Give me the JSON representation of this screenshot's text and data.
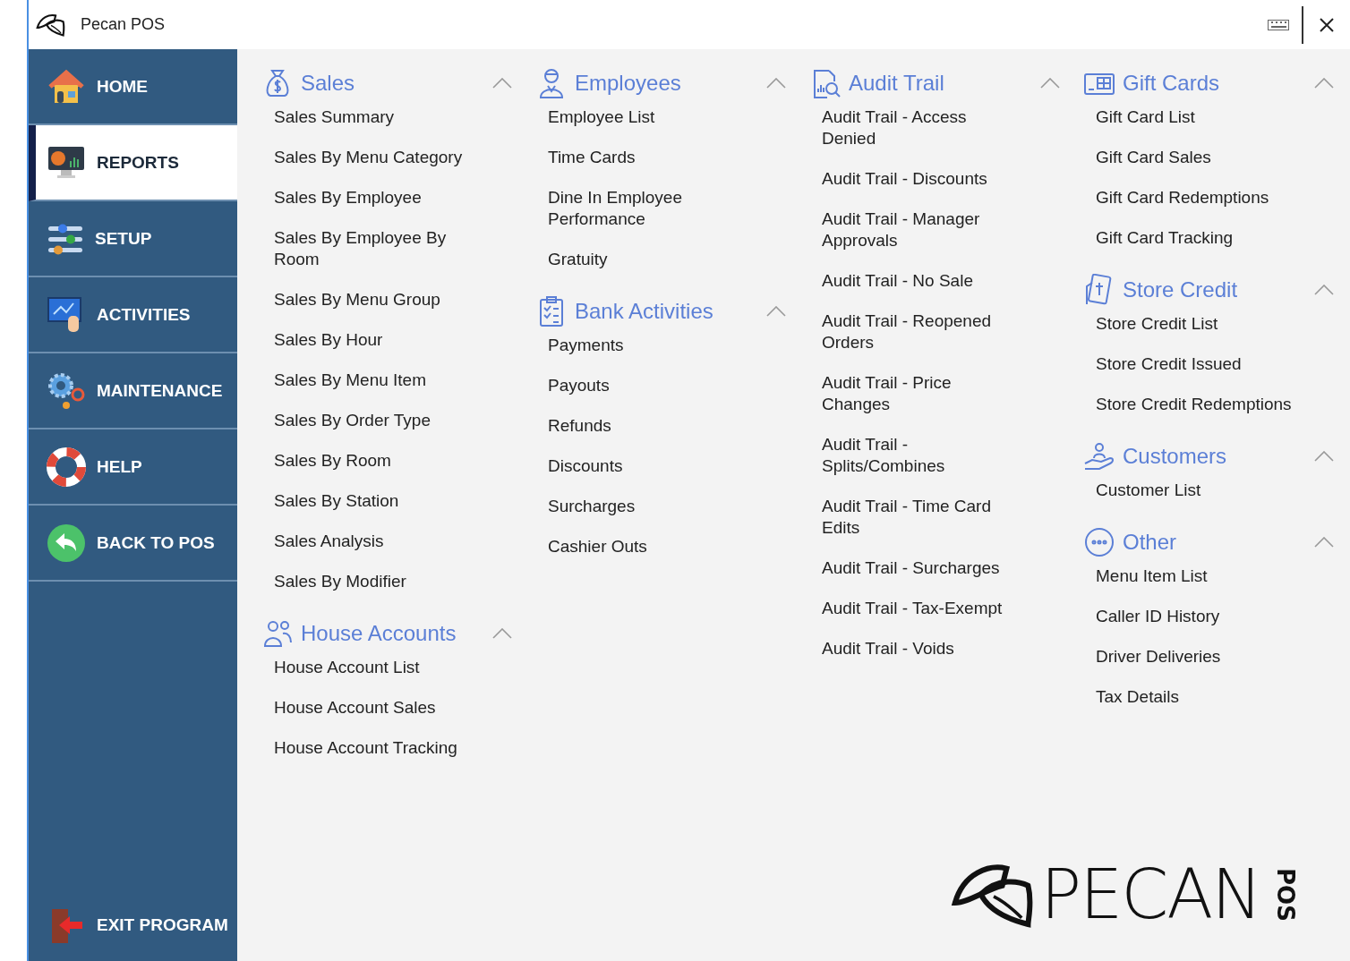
{
  "window": {
    "title": "Pecan POS"
  },
  "sidebar": {
    "items": [
      {
        "label": "HOME",
        "kind": "home",
        "selected": false
      },
      {
        "label": "REPORTS",
        "kind": "reports",
        "selected": true
      },
      {
        "label": "SETUP",
        "kind": "setup",
        "selected": false
      },
      {
        "label": "ACTIVITIES",
        "kind": "activities",
        "selected": false
      },
      {
        "label": "MAINTENANCE",
        "kind": "maintenance",
        "selected": false
      },
      {
        "label": "HELP",
        "kind": "help",
        "selected": false
      },
      {
        "label": "BACK TO POS",
        "kind": "back",
        "selected": false
      }
    ],
    "exit": {
      "label": "EXIT PROGRAM"
    }
  },
  "columns": [
    {
      "sections": [
        {
          "title": "Sales",
          "kind": "moneybag",
          "expanded": true,
          "items": [
            "Sales Summary",
            "Sales By Menu Category",
            "Sales By Employee",
            "Sales By Employee By Room",
            "Sales By Menu Group",
            "Sales By Hour",
            "Sales By Menu Item",
            "Sales By Order Type",
            "Sales By Room",
            "Sales By Station",
            "Sales Analysis",
            "Sales By Modifier"
          ]
        },
        {
          "title": "House Accounts",
          "kind": "people",
          "expanded": true,
          "items": [
            "House Account List",
            "House Account Sales",
            "House Account Tracking"
          ]
        }
      ]
    },
    {
      "sections": [
        {
          "title": "Employees",
          "kind": "employee",
          "expanded": true,
          "items": [
            "Employee List",
            "Time Cards",
            "Dine In Employee Performance",
            "Gratuity"
          ]
        },
        {
          "title": "Bank Activities",
          "kind": "clipboard",
          "expanded": true,
          "items": [
            "Payments",
            "Payouts",
            "Refunds",
            "Discounts",
            "Surcharges",
            "Cashier Outs"
          ]
        }
      ]
    },
    {
      "sections": [
        {
          "title": "Audit Trail",
          "kind": "audit",
          "expanded": true,
          "items": [
            "Audit Trail - Access Denied",
            "Audit Trail - Discounts",
            "Audit Trail - Manager Approvals",
            "Audit Trail - No Sale",
            "Audit Trail - Reopened Orders",
            "Audit Trail - Price Changes",
            "Audit Trail - Splits/Combines",
            "Audit Trail - Time Card Edits",
            "Audit Trail - Surcharges",
            "Audit Trail - Tax-Exempt",
            "Audit Trail - Voids"
          ]
        }
      ]
    },
    {
      "sections": [
        {
          "title": "Gift Cards",
          "kind": "giftcard",
          "expanded": true,
          "items": [
            "Gift Card List",
            "Gift Card Sales",
            "Gift Card Redemptions",
            "Gift Card Tracking"
          ]
        },
        {
          "title": "Store Credit",
          "kind": "credit",
          "expanded": true,
          "items": [
            "Store Credit List",
            "Store Credit Issued",
            "Store Credit Redemptions"
          ]
        },
        {
          "title": "Customers",
          "kind": "customer",
          "expanded": true,
          "items": [
            "Customer List"
          ]
        },
        {
          "title": "Other",
          "kind": "other",
          "expanded": true,
          "items": [
            "Menu Item List",
            "Caller ID History",
            "Driver Deliveries",
            "Tax Details"
          ]
        }
      ]
    }
  ],
  "logo": {
    "wordmark": "PECAN",
    "suffix": "POS"
  }
}
